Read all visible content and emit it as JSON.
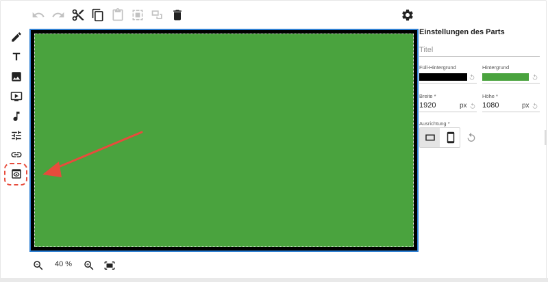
{
  "toolbar": {
    "icons": [
      "undo-icon",
      "redo-icon",
      "cut-icon",
      "copy-icon",
      "paste-icon",
      "group-icon",
      "ungroup-icon",
      "delete-icon",
      "gear-icon"
    ]
  },
  "sidebar": {
    "items": [
      "pencil-icon",
      "text-icon",
      "image-icon",
      "video-icon",
      "music-icon",
      "sliders-icon",
      "link-icon",
      "preview-icon"
    ]
  },
  "canvas": {
    "background_color": "#4aa33e",
    "fill_color": "#000000",
    "border_color": "#2f80d3"
  },
  "annotation": {
    "color": "#e74c3c"
  },
  "zoom": {
    "value": "40 %"
  },
  "panel": {
    "title": "Einstellungen des Parts",
    "title_placeholder": "Titel",
    "fill_background_label": "Füll-Hintergrund",
    "fill_background_color": "#000000",
    "background_label": "Hintergrund",
    "background_color": "#4aa33e",
    "width_label": "Breite *",
    "width_value": "1920",
    "width_unit": "px",
    "height_label": "Höhe *",
    "height_value": "1080",
    "height_unit": "px",
    "orientation_label": "Ausrichtung *",
    "orientation_selected": "landscape"
  }
}
